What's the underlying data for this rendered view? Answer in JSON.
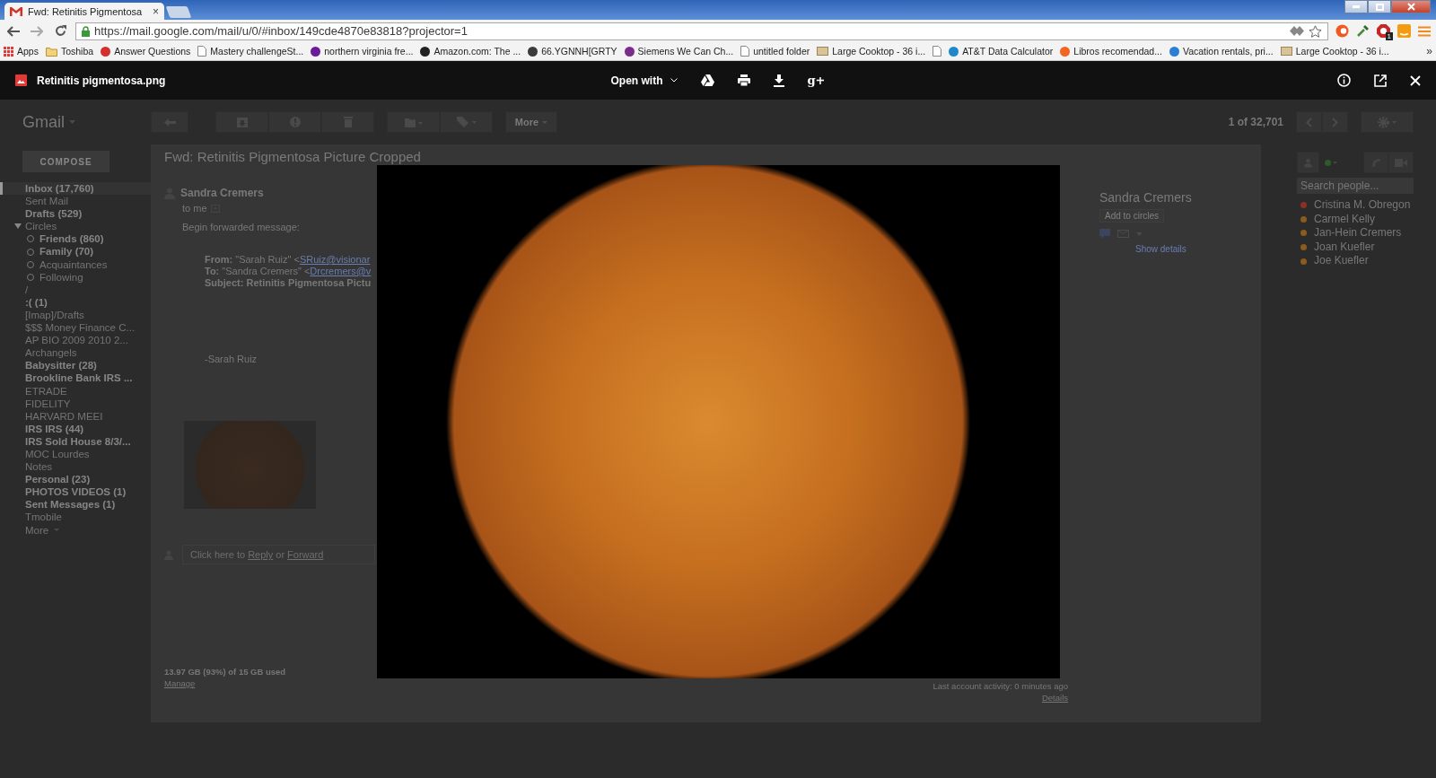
{
  "browser": {
    "tab": {
      "title": "Fwd: Retinitis Pigmentosa",
      "close": "×"
    },
    "url": "https://mail.google.com/mail/u/0/#inbox/149cde4870e83818?projector=1",
    "extension_badge": "1"
  },
  "bookmarks": [
    {
      "kind": "apps",
      "label": "Apps"
    },
    {
      "kind": "folder",
      "label": "Toshiba"
    },
    {
      "kind": "site",
      "color": "#d32f2f",
      "label": "Answer Questions"
    },
    {
      "kind": "page",
      "label": "Mastery challengeSt..."
    },
    {
      "kind": "site",
      "color": "#6a1b9a",
      "label": "northern virginia fre..."
    },
    {
      "kind": "site",
      "color": "#222222",
      "label": "Amazon.com: The ..."
    },
    {
      "kind": "site",
      "color": "#3b3b3b",
      "label": "66.YGNNH[GRTY"
    },
    {
      "kind": "site",
      "color": "#7b2d8b",
      "label": "Siemens We Can Ch..."
    },
    {
      "kind": "page",
      "label": "untitled folder"
    },
    {
      "kind": "image",
      "label": "Large Cooktop - 36 i..."
    },
    {
      "kind": "page"
    },
    {
      "kind": "site",
      "color": "#1e88c8",
      "label": "AT&T Data Calculator"
    },
    {
      "kind": "site",
      "color": "#f26522",
      "label": "Libros recomendad..."
    },
    {
      "kind": "site",
      "color": "#2a7fd4",
      "label": "Vacation rentals, pri..."
    },
    {
      "kind": "image",
      "label": "Large Cooktop - 36 i..."
    }
  ],
  "bookmarks_overflow": "»",
  "viewer": {
    "filename": "Retinitis pigmentosa.png",
    "open_with": "Open with",
    "share_label": "g+"
  },
  "gmail": {
    "logo": "Gmail",
    "toolbar_more": "More",
    "pager": "1 of 32,701",
    "compose": "COMPOSE",
    "nav": [
      {
        "label": "Inbox (17,760)",
        "unread": true,
        "selected": true
      },
      {
        "label": "Sent Mail",
        "unread": false,
        "selected": false
      },
      {
        "label": "Drafts (529)",
        "unread": true,
        "selected": false
      },
      {
        "label": "Circles",
        "unread": false,
        "selected": false,
        "expanded": true,
        "children": [
          {
            "label": "Friends (860)",
            "unread": true,
            "selected": false
          },
          {
            "label": "Family (70)",
            "unread": true,
            "selected": false
          },
          {
            "label": "Acquaintances",
            "unread": false,
            "selected": false
          },
          {
            "label": "Following",
            "unread": false,
            "selected": false
          }
        ]
      },
      {
        "label": "/",
        "unread": false,
        "selected": false
      },
      {
        "label": ":( (1)",
        "unread": true,
        "selected": false
      },
      {
        "label": "[Imap]/Drafts",
        "unread": false,
        "selected": false
      },
      {
        "label": "$$$ Money Finance C...",
        "unread": false,
        "selected": false
      },
      {
        "label": "AP BIO 2009 2010 2...",
        "unread": false,
        "selected": false
      },
      {
        "label": "Archangels",
        "unread": false,
        "selected": false
      },
      {
        "label": "Babysitter (28)",
        "unread": true,
        "selected": false
      },
      {
        "label": "Brookline Bank IRS ...",
        "unread": true,
        "selected": false
      },
      {
        "label": "ETRADE",
        "unread": false,
        "selected": false
      },
      {
        "label": "FIDELITY",
        "unread": false,
        "selected": false
      },
      {
        "label": "HARVARD MEEI",
        "unread": false,
        "selected": false
      },
      {
        "label": "IRS IRS (44)",
        "unread": true,
        "selected": false
      },
      {
        "label": "IRS Sold House 8/3/...",
        "unread": true,
        "selected": false
      },
      {
        "label": "MOC Lourdes",
        "unread": false,
        "selected": false
      },
      {
        "label": "Notes",
        "unread": false,
        "selected": false
      },
      {
        "label": "Personal (23)",
        "unread": true,
        "selected": false
      },
      {
        "label": "PHOTOS VIDEOS (1)",
        "unread": true,
        "selected": false
      },
      {
        "label": "Sent Messages (1)",
        "unread": true,
        "selected": false
      },
      {
        "label": "Tmobile",
        "unread": false,
        "selected": false
      }
    ],
    "nav_more": "More",
    "message": {
      "subject": "Fwd: Retinitis Pigmentosa Picture Cropped",
      "sender": "Sandra Cremers",
      "recipient": "to me",
      "intro": "Begin forwarded message:",
      "from_text": "**From:** \"Sarah Ruiz\" <",
      "from_email": "SRuiz@visionar",
      "to_text": "**To:** \"Sandra Cremers\" <",
      "to_email": "Drcremers@v",
      "subject_line": "Subject: Retinitis Pigmentosa Pictu",
      "signature": "-Sarah Ruiz",
      "reply_prompt": "Click here to",
      "reply_link": "Reply",
      "reply_or": "or",
      "forward_link": "Forward"
    },
    "contact_card": {
      "name": "Sandra Cremers",
      "add_button": "Add to circles",
      "show_details": "Show details"
    },
    "people": {
      "search_placeholder": "Search people...",
      "contacts": [
        {
          "name": "Cristina M. Obregon",
          "color": "#8c2f25"
        },
        {
          "name": "Carmel Kelly",
          "color": "#8c5a1c"
        },
        {
          "name": "Jan-Hein Cremers",
          "color": "#8c5a1c"
        },
        {
          "name": "Joan Kuefler",
          "color": "#8c5a1c"
        },
        {
          "name": "Joe Kuefler",
          "color": "#8c5a1c"
        }
      ]
    },
    "footer": {
      "storage": "13.97 GB (93%) of 15 GB used",
      "manage": "Manage",
      "activity": "Last account activity: 0 minutes ago",
      "details": "Details"
    }
  }
}
